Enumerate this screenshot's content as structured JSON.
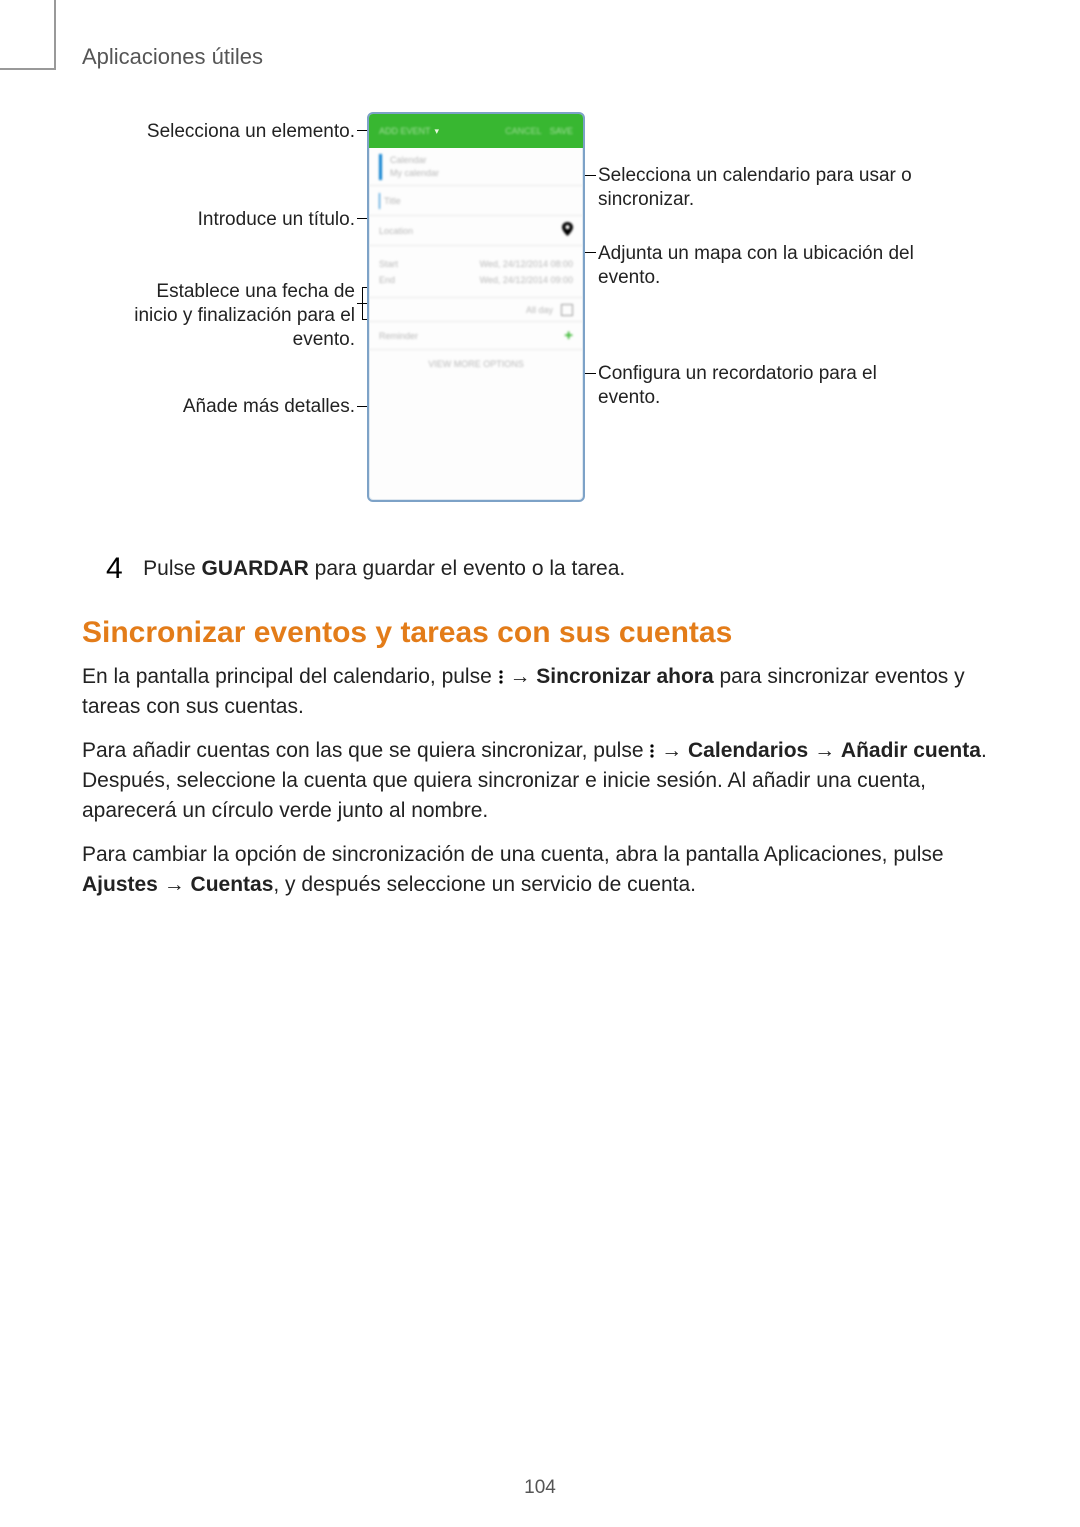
{
  "page": {
    "chapter": "Aplicaciones útiles",
    "number": "104"
  },
  "callouts": {
    "select_element": "Selecciona un elemento.",
    "enter_title": "Introduce un título.",
    "set_dates": "Establece una fecha de inicio y finalización para el evento.",
    "add_details": "Añade más detalles.",
    "select_calendar": "Selecciona un calendario para usar o sincronizar.",
    "attach_map": "Adjunta un mapa con la ubicación del evento.",
    "set_reminder": "Configura un recordatorio para el evento."
  },
  "phone": {
    "topbar_left": "Add event",
    "topbar_cancel": "CANCEL",
    "topbar_save": "SAVE",
    "cal_line1": "Calendar",
    "cal_line2": "My calendar",
    "title_placeholder": "Title",
    "location_label": "Location",
    "start_label": "Start",
    "end_label": "End",
    "start_value": "Wed, 24/12/2014   08:00",
    "end_value": "Wed, 24/12/2014   09:00",
    "allday_label": "All day",
    "reminder_label": "Reminder",
    "more_label": "VIEW MORE OPTIONS"
  },
  "step4": {
    "number": "4",
    "before": "Pulse ",
    "bold": "GUARDAR",
    "after": " para guardar el evento o la tarea."
  },
  "heading": "Sincronizar eventos y tareas con sus cuentas",
  "para1": {
    "a": "En la pantalla principal del calendario, pulse ",
    "arrow1": " → ",
    "b": "Sincronizar ahora",
    "c": " para sincronizar eventos y tareas con sus cuentas."
  },
  "para2": {
    "a": "Para añadir cuentas con las que se quiera sincronizar, pulse ",
    "arrow1": " → ",
    "b": "Calendarios",
    "arrow2": " → ",
    "c": "Añadir cuenta",
    "d": ". Después, seleccione la cuenta que quiera sincronizar e inicie sesión. Al añadir una cuenta, aparecerá un círculo verde junto al nombre."
  },
  "para3": {
    "a": "Para cambiar la opción de sincronización de una cuenta, abra la pantalla Aplicaciones, pulse ",
    "b": "Ajustes",
    "arrow": " → ",
    "c": "Cuentas",
    "d": ", y después seleccione un servicio de cuenta."
  }
}
